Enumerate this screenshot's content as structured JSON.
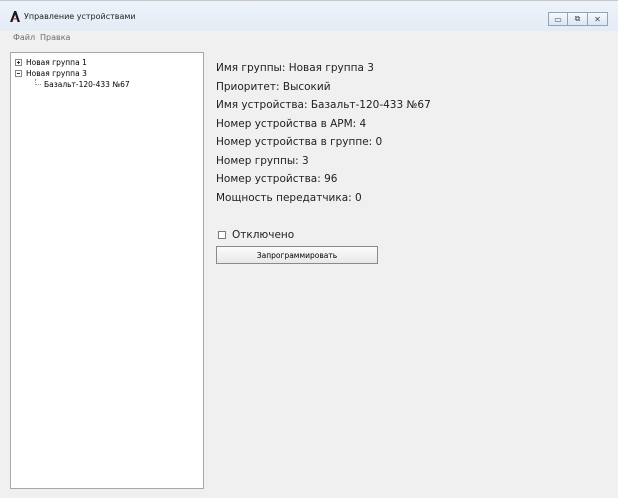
{
  "window": {
    "title": "Управление устройствами",
    "controls": {
      "minimize": "▭",
      "maximize": "⧉",
      "close": "✕"
    }
  },
  "menu": {
    "items": [
      {
        "label": "Файл"
      },
      {
        "label": "Правка"
      }
    ]
  },
  "tree": {
    "nodes": [
      {
        "label": "Новая группа 1",
        "expanded": false
      },
      {
        "label": "Новая группа 3",
        "expanded": true,
        "children": [
          {
            "label": "Базальт-120-433 №67"
          }
        ]
      }
    ]
  },
  "details": {
    "group_name": "Имя группы: Новая группа 3",
    "priority": "Приоритет: Высокий",
    "device_name": "Имя устройства: Базальт-120-433 №67",
    "device_number_arm": "Номер устройства в АРМ: 4",
    "device_number_group": "Номер устройства в группе: 0",
    "group_number": "Номер группы: 3",
    "device_number": "Номер устройства: 96",
    "tx_power": "Мощность передатчика: 0"
  },
  "disabled_checkbox": {
    "label": "Отключено",
    "checked": false
  },
  "program_button": {
    "label": "Запрограммировать"
  },
  "colors": {
    "accent": "#000000",
    "title_bg": "#e3ebf5",
    "pane_bg": "#ffffff"
  },
  "icons": {
    "app": "app-logo-icon"
  }
}
